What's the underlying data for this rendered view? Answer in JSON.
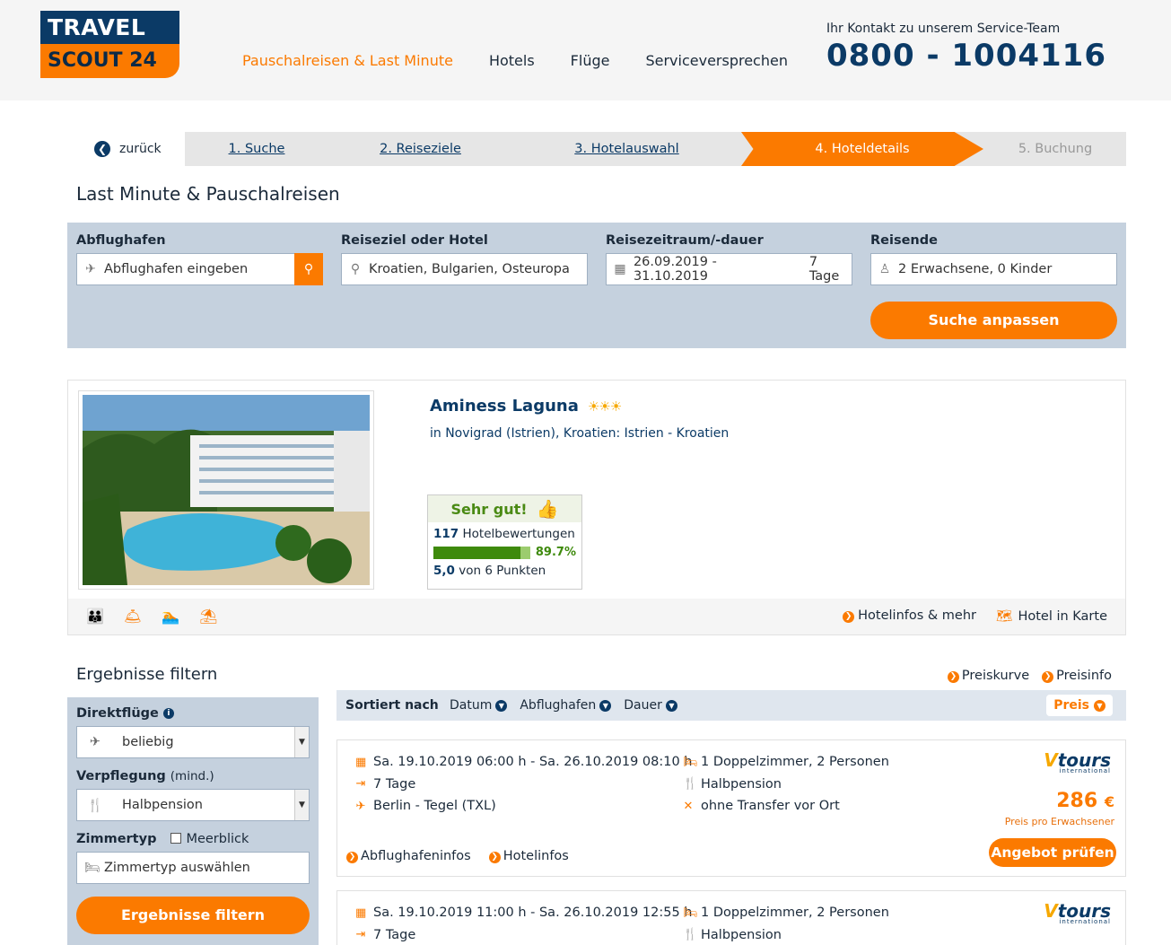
{
  "brand": {
    "line1": "TRAVEL",
    "line2": "SCOUT 24"
  },
  "nav": {
    "items": [
      "Pauschalreisen & Last Minute",
      "Hotels",
      "Flüge",
      "Serviceversprechen"
    ]
  },
  "contact": {
    "label": "Ihr Kontakt zu unserem Service-Team",
    "phone": "0800 - 1004116"
  },
  "steps": {
    "back": "zurück",
    "items": [
      "1. Suche",
      "2. Reiseziele",
      "3. Hotelauswahl",
      "4. Hoteldetails",
      "5. Buchung"
    ]
  },
  "page_title": "Last Minute & Pauschalreisen",
  "search": {
    "airport_label": "Abflughafen",
    "airport_placeholder": "Abflughafen eingeben",
    "destination_label": "Reiseziel oder Hotel",
    "destination_value": "Kroatien, Bulgarien, Osteuropa",
    "period_label": "Reisezeitraum/-dauer",
    "period_dates": "26.09.2019 - 31.10.2019",
    "period_duration": "7 Tage",
    "travelers_label": "Reisende",
    "travelers_value": "2 Erwachsene, 0 Kinder",
    "submit": "Suche anpassen"
  },
  "hotel": {
    "name": "Aminess Laguna",
    "stars": "☀☀☀",
    "location": "in Novigrad (Istrien), Kroatien: Istrien - Kroatien",
    "rating_head": "Sehr gut!",
    "review_count": "117",
    "review_label": "Hotelbewertungen",
    "recommend_pct": "89.7%",
    "recommend_fraction": 0.897,
    "score": "5,0",
    "score_label": "von 6 Punkten",
    "link_info": "Hotelinfos & mehr",
    "link_map": "Hotel in Karte"
  },
  "filter": {
    "title": "Ergebnisse filtern",
    "link_curve": "Preiskurve",
    "link_info": "Preisinfo",
    "direct_label": "Direktflüge",
    "direct_value": "beliebig",
    "board_label": "Verpflegung",
    "board_sub": "(mind.)",
    "board_value": "Halbpension",
    "room_label": "Zimmertyp",
    "seaview_label": "Meerblick",
    "room_placeholder": "Zimmertyp auswählen",
    "submit": "Ergebnisse filtern"
  },
  "sort": {
    "label": "Sortiert nach",
    "options": [
      "Datum",
      "Abflughafen",
      "Dauer"
    ],
    "active": "Preis"
  },
  "results": [
    {
      "dates": "Sa. 19.10.2019 06:00 h - Sa. 26.10.2019 08:10 h",
      "duration": "7 Tage",
      "airport": "Berlin - Tegel (TXL)",
      "room": "1 Doppelzimmer, 2 Personen",
      "board": "Halbpension",
      "transfer": "ohne Transfer vor Ort",
      "operator": "tours",
      "operator_sub": "international",
      "price": "286",
      "currency": "€",
      "price_note": "Preis pro Erwachsener",
      "link_airport": "Abflughafeninfos",
      "link_hotel": "Hotelinfos",
      "cta": "Angebot prüfen"
    },
    {
      "dates": "Sa. 19.10.2019 11:00 h - Sa. 26.10.2019 12:55 h",
      "duration": "7 Tage",
      "room": "1 Doppelzimmer, 2 Personen",
      "board": "Halbpension",
      "operator": "tours",
      "operator_sub": "international"
    }
  ],
  "colors": {
    "brand_blue": "#0b3a66",
    "accent_orange": "#fb7a00",
    "panel_blue": "#c5d1de",
    "rating_green": "#3e8a0c"
  }
}
